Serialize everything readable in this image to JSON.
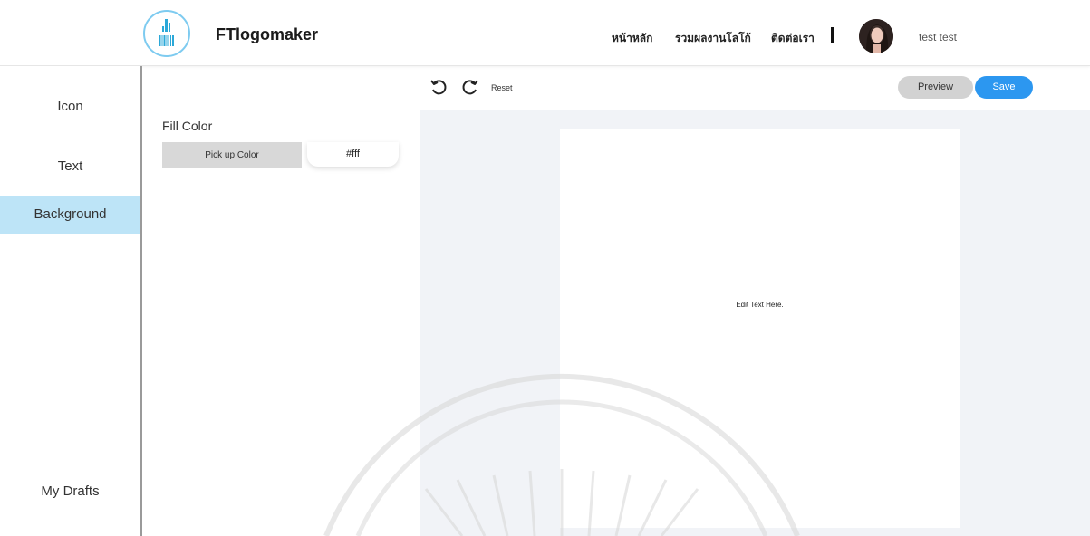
{
  "header": {
    "brand": "FTlogomaker",
    "nav": [
      "หน้าหลัก",
      "รวมผลงานโลโก้",
      "ติดต่อเรา"
    ],
    "username": "test test",
    "logo_icon": "barcode-logo-icon",
    "avatar_icon": "user-avatar"
  },
  "sidebar": {
    "items": [
      "Icon",
      "Text",
      "Background"
    ],
    "active": "Background",
    "drafts": "My Drafts"
  },
  "panel": {
    "fill_color_title": "Fill Color",
    "pick_button": "Pick up Color",
    "color_value": "#fff"
  },
  "toolbar": {
    "undo_icon": "undo-icon",
    "redo_icon": "redo-icon",
    "reset": "Reset",
    "preview": "Preview",
    "save": "Save"
  },
  "canvas": {
    "text": "Edit Text Here."
  },
  "colors": {
    "accent": "#2c97f0",
    "sidebar_active": "#bde4f7",
    "logo_ring": "#7ecbf0",
    "workspace": "#f1f3f7"
  }
}
